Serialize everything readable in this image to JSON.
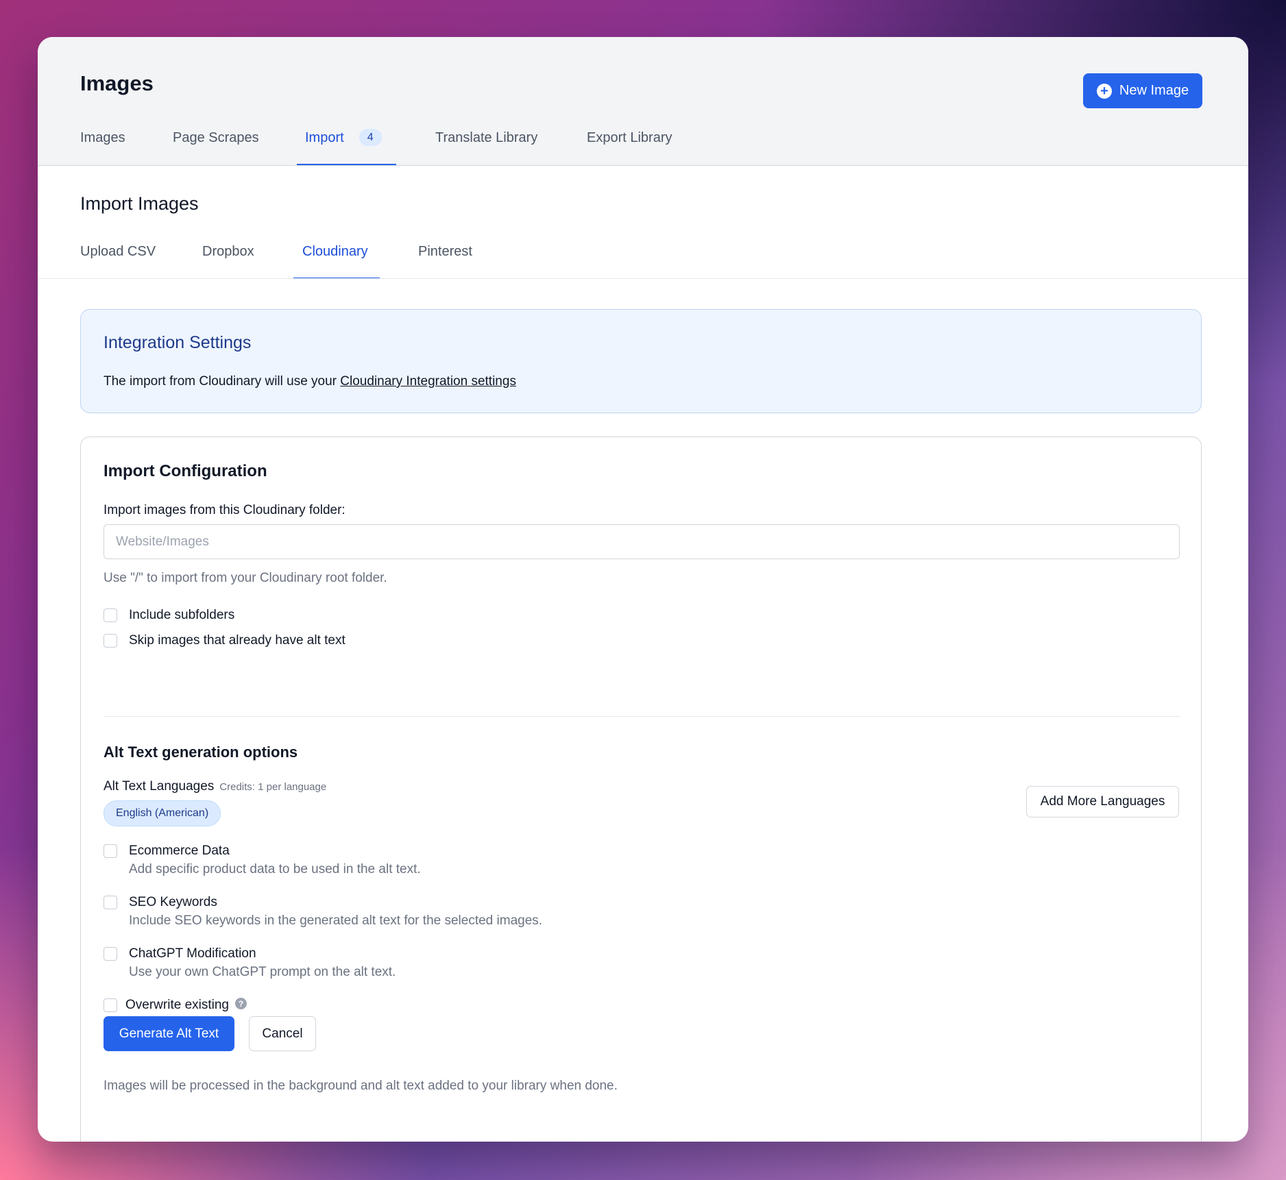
{
  "header": {
    "title": "Images",
    "new_button": "New Image",
    "tabs": [
      {
        "label": "Images"
      },
      {
        "label": "Page Scrapes"
      },
      {
        "label": "Import",
        "badge": "4",
        "active": true
      },
      {
        "label": "Translate Library"
      },
      {
        "label": "Export Library"
      }
    ]
  },
  "import": {
    "title": "Import Images",
    "tabs": [
      {
        "label": "Upload CSV"
      },
      {
        "label": "Dropbox"
      },
      {
        "label": "Cloudinary",
        "active": true
      },
      {
        "label": "Pinterest"
      }
    ]
  },
  "integration": {
    "title": "Integration Settings",
    "text": "The import from Cloudinary will use your ",
    "link": "Cloudinary Integration settings"
  },
  "config": {
    "title": "Import Configuration",
    "folder_label": "Import images from this Cloudinary folder:",
    "folder_placeholder": "Website/Images",
    "folder_value": "",
    "hint": "Use \"/\" to import from your Cloudinary root folder.",
    "include_subfolders": "Include subfolders",
    "skip_existing": "Skip images that already have alt text"
  },
  "alt_text": {
    "title": "Alt Text generation options",
    "languages_label": "Alt Text Languages",
    "credits": "Credits: 1 per language",
    "language_chip": "English (American)",
    "add_languages": "Add More Languages",
    "ecommerce_label": "Ecommerce Data",
    "ecommerce_desc": "Add specific product data to be used in the alt text.",
    "seo_label": "SEO Keywords",
    "seo_desc": "Include SEO keywords in the generated alt text for the selected images.",
    "chatgpt_label": "ChatGPT Modification",
    "chatgpt_desc": "Use your own ChatGPT prompt on the alt text.",
    "overwrite_label": "Overwrite existing",
    "help_glyph": "?"
  },
  "actions": {
    "generate": "Generate Alt Text",
    "cancel": "Cancel",
    "note": "Images will be processed in the background and alt text added to your library when done."
  },
  "colors": {
    "accent": "#2563eb",
    "info_bg": "#eef5ff",
    "info_title": "#1e3a8a"
  },
  "icons": {
    "new_button_icon": "plus-circle-icon",
    "overwrite_help_icon": "question-circle-icon"
  }
}
